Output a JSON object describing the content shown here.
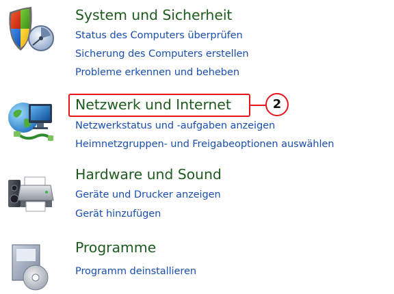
{
  "categories": [
    {
      "title": "System und Sicherheit",
      "icon": "shield-icon",
      "links": [
        "Status des Computers überprüfen",
        "Sicherung des Computers erstellen",
        "Probleme erkennen und beheben"
      ]
    },
    {
      "title": "Netzwerk und Internet",
      "icon": "network-globe-icon",
      "links": [
        "Netzwerkstatus und -aufgaben anzeigen",
        "Heimnetzgruppen- und Freigabeoptionen auswählen"
      ]
    },
    {
      "title": "Hardware und Sound",
      "icon": "printer-speaker-icon",
      "links": [
        "Geräte und Drucker anzeigen",
        "Gerät hinzufügen"
      ]
    },
    {
      "title": "Programme",
      "icon": "programs-disc-icon",
      "links": [
        "Programm deinstallieren"
      ]
    }
  ],
  "annotation": {
    "step_number": "2",
    "color": "#e8141c"
  },
  "colors": {
    "title": "#1e5b1e",
    "link": "#1a4fb0"
  }
}
